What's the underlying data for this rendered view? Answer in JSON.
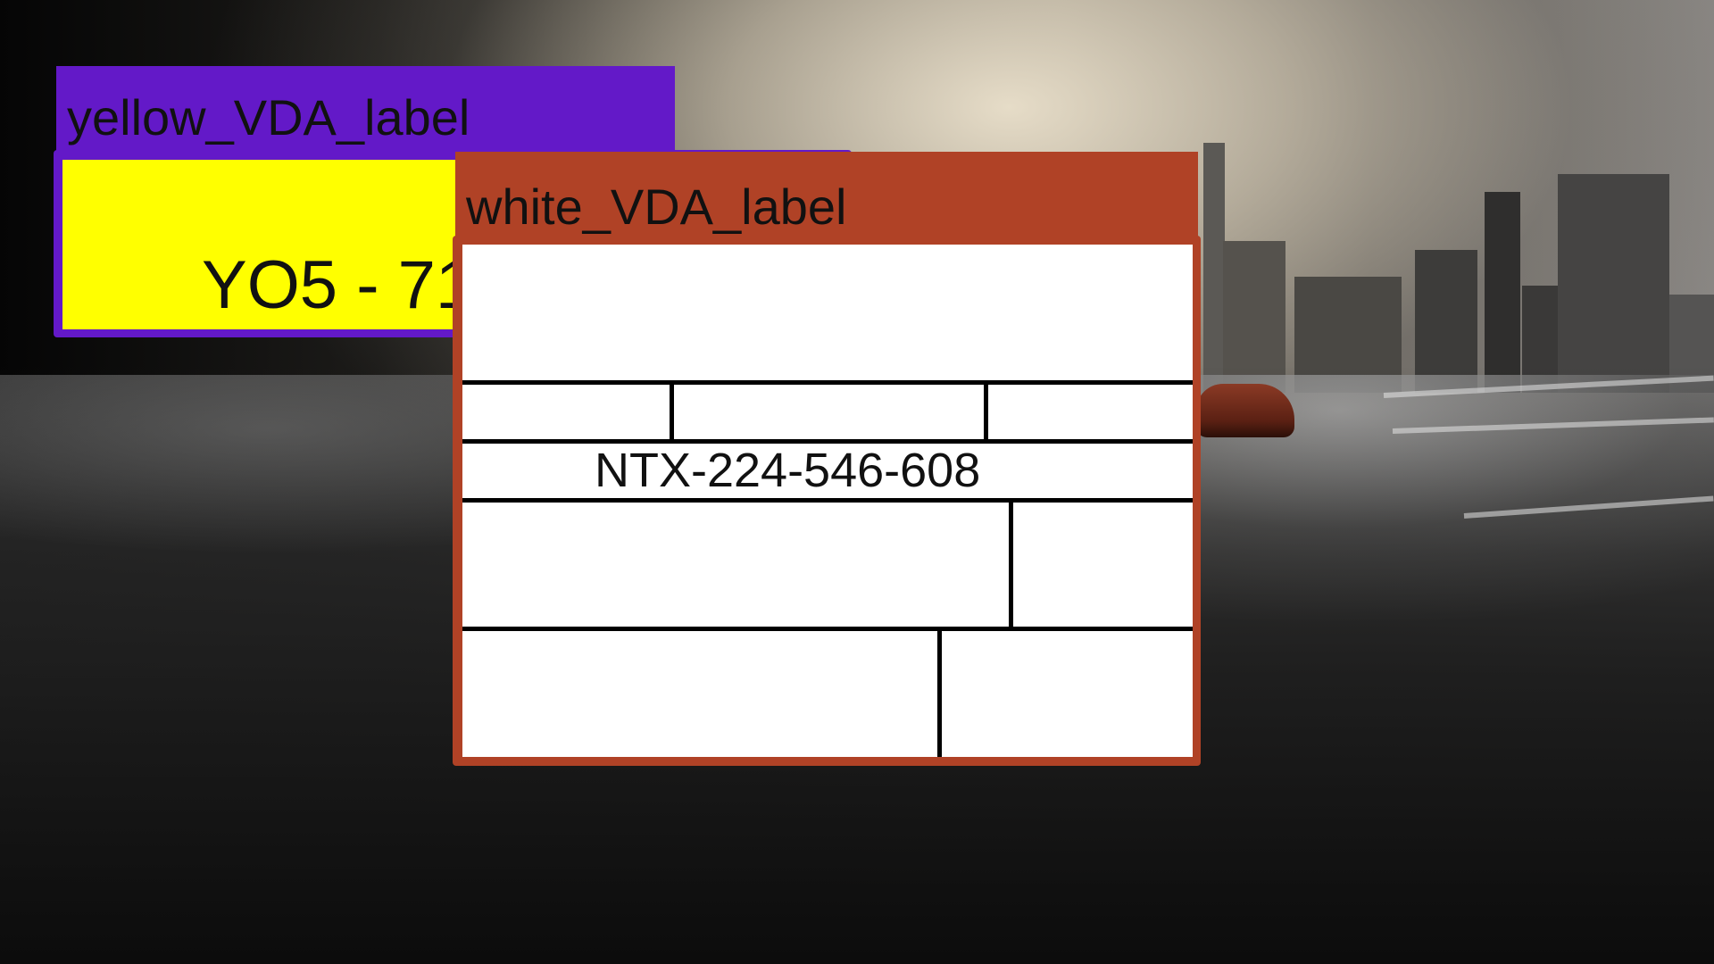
{
  "yellow_label": {
    "tag": "yellow_VDA_label",
    "plate_text": "YO5 - 71",
    "tag_color": "#6319c8",
    "plate_color": "#ffff00"
  },
  "white_label": {
    "tag": "white_VDA_label",
    "plate_text": "NTX-224-546-608",
    "tag_color": "#b04226",
    "plate_color": "#ffffff"
  }
}
